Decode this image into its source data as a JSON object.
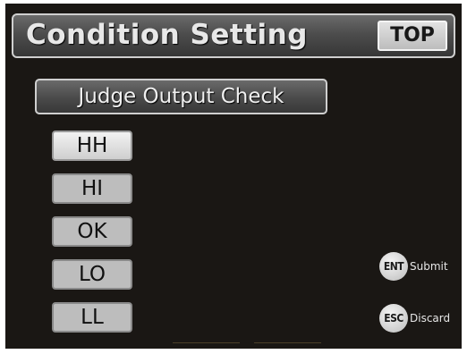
{
  "header": {
    "title": "Condition Setting",
    "top_button": "TOP"
  },
  "judge_output_check": {
    "label": "Judge Output Check",
    "items": [
      {
        "label": "HH",
        "selected": true
      },
      {
        "label": "HI",
        "selected": false
      },
      {
        "label": "OK",
        "selected": false
      },
      {
        "label": "LO",
        "selected": false
      },
      {
        "label": "LL",
        "selected": false
      }
    ]
  },
  "keys": {
    "submit": {
      "key": "ENT",
      "label": "Submit"
    },
    "discard": {
      "key": "ESC",
      "label": "Discard"
    }
  }
}
